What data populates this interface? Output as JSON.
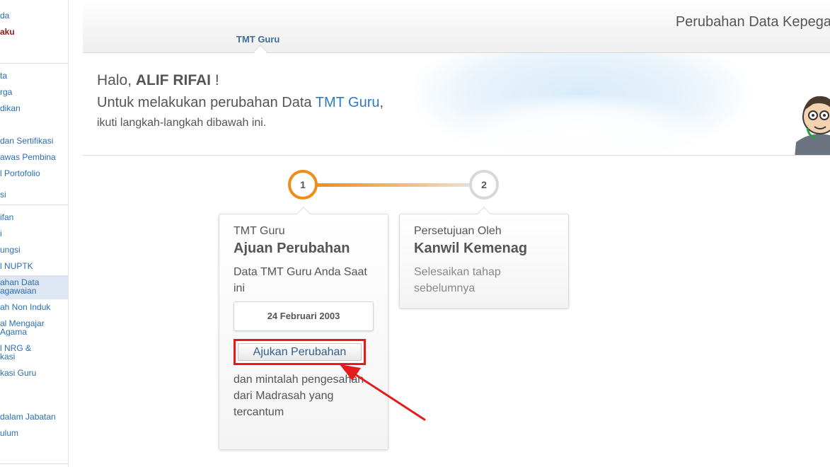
{
  "sidebar": {
    "items": [
      {
        "label": "da",
        "style": "normal"
      },
      {
        "label": "aku",
        "style": "dark"
      },
      {
        "label": "ta",
        "style": "normal"
      },
      {
        "label": "rga",
        "style": "normal"
      },
      {
        "label": "dikan",
        "style": "normal"
      },
      {
        "label": "dan Sertifikasi",
        "style": "normal"
      },
      {
        "label": "awas Pembina",
        "style": "normal"
      },
      {
        "label": "l Portofolio",
        "style": "normal"
      },
      {
        "label": "si",
        "style": "normal"
      },
      {
        "label": "ifan",
        "style": "normal"
      },
      {
        "label": "i",
        "style": "normal"
      },
      {
        "label": "ungsi",
        "style": "normal"
      },
      {
        "label": "l NUPTK",
        "style": "normal"
      },
      {
        "label": "ahan Data\nagawaian",
        "style": "active"
      },
      {
        "label": "ah Non Induk",
        "style": "normal"
      },
      {
        "label": "al Mengajar\nAgama",
        "style": "normal"
      },
      {
        "label": "l NRG &\nkasi",
        "style": "normal"
      },
      {
        "label": "kasi Guru",
        "style": "normal"
      },
      {
        "label": "dalam Jabatan",
        "style": "normal"
      },
      {
        "label": "ulum",
        "style": "normal"
      }
    ]
  },
  "header": {
    "title": "Perubahan Data Kepega",
    "tab": "TMT Guru"
  },
  "greeting": {
    "hello": "Halo, ",
    "name": "ALIF RIFAI",
    "exclaim": " !",
    "line2_prefix": "Untuk melakukan perubahan Data ",
    "line2_highlight": "TMT Guru",
    "line2_suffix": ",",
    "line3": "ikuti langkah-langkah dibawah ini."
  },
  "steps": [
    {
      "number": "1",
      "subtitle": "TMT Guru",
      "title": "Ajuan Perubahan",
      "description": "Data TMT Guru Anda Saat ini",
      "current_value": "24 Februari 2003",
      "button_label": "Ajukan Perubahan",
      "after_text": "dan mintalah pengesahan dari Madrasah yang tercantum"
    },
    {
      "number": "2",
      "subtitle": "Persetujuan Oleh",
      "title": "Kanwil Kemenag",
      "description": "Selesaikan tahap sebelumnya"
    }
  ],
  "colors": {
    "accent_orange": "#f08c1a",
    "link_blue": "#2b7bc6",
    "highlight_red": "#e51a1a"
  }
}
